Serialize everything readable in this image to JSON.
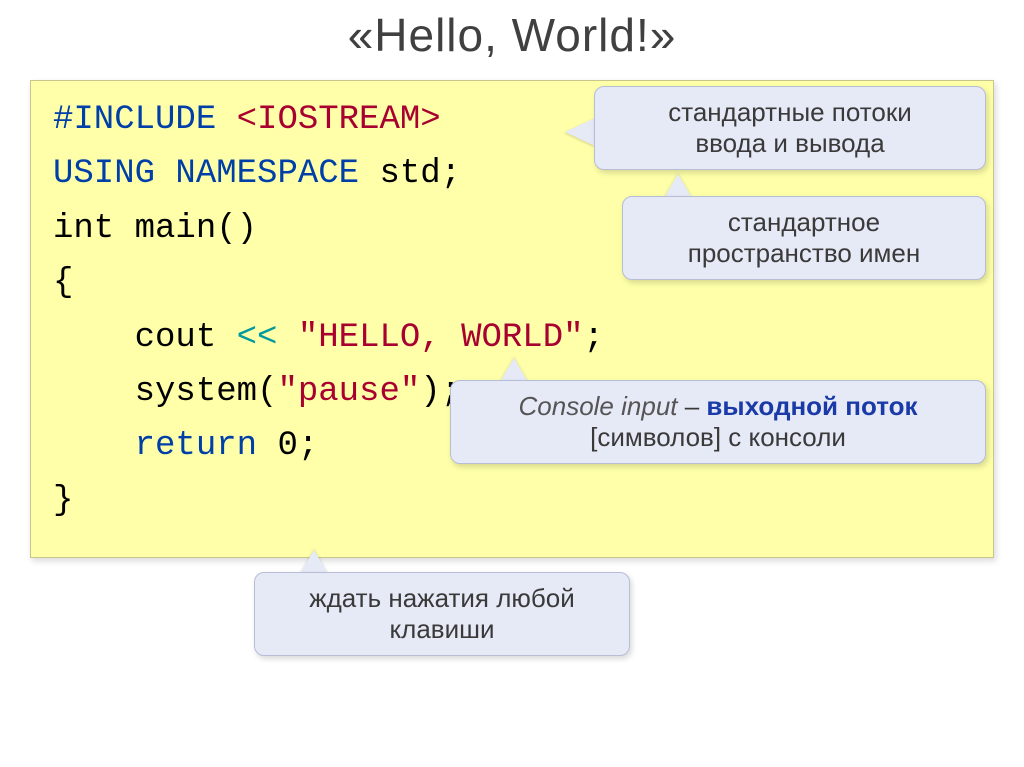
{
  "title": "«Hello, World!»",
  "code": {
    "l1a": "#include ",
    "l1b": "<iostream>",
    "l2a": "using ",
    "l2b": "namespace ",
    "l2c": "std;",
    "l3": "int main()",
    "l4": "{",
    "l5a": "    cout ",
    "l5b": "<< ",
    "l5c": "\"Hello, World\"",
    "l5d": ";",
    "l6a": "    system(",
    "l6b": "\"pause\"",
    "l6c": ");",
    "l7a": "    return ",
    "l7b": "0",
    "l7c": ";",
    "l8": "}"
  },
  "callouts": {
    "c1_line1": "стандартные потоки",
    "c1_line2": "ввода и вывода",
    "c2_line1": "стандартное",
    "c2_line2": "пространство имен",
    "c3_italic": "Console input",
    "c3_dash": " – ",
    "c3_bold": "выходной поток",
    "c3_line2": "[символов] с консоли",
    "c4_line1": "ждать нажатия любой",
    "c4_line2": "клавиши"
  }
}
